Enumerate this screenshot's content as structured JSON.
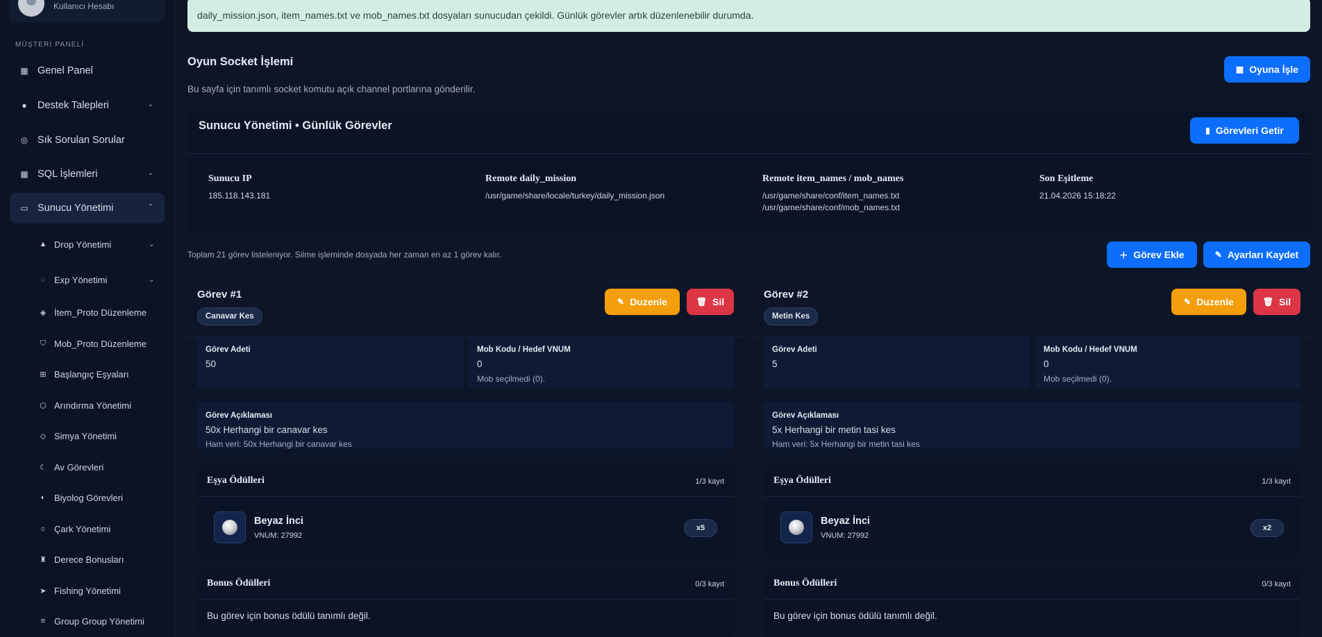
{
  "sidebar": {
    "user_subtitle": "Kullanıcı Hesabı",
    "section_label": "MÜŞTERİ PANELİ",
    "items": [
      {
        "label": "Genel Panel"
      },
      {
        "label": "Destek Talepleri"
      },
      {
        "label": "Sık Sorulan Sorular"
      },
      {
        "label": "SQL İşlemleri"
      },
      {
        "label": "Sunucu Yönetimi"
      }
    ],
    "sub_items": [
      {
        "label": "Drop Yönetimi"
      },
      {
        "label": "Exp Yönetimi"
      },
      {
        "label": "İtem_Proto Düzenleme"
      },
      {
        "label": "Mob_Proto Düzenleme"
      },
      {
        "label": "Başlangıç Eşyaları"
      },
      {
        "label": "Arındırma Yönetimi"
      },
      {
        "label": "Simya Yönetimi"
      },
      {
        "label": "Av Görevleri"
      },
      {
        "label": "Biyolog Görevleri"
      },
      {
        "label": "Çark Yönetimi"
      },
      {
        "label": "Derece Bonusları"
      },
      {
        "label": "Fishing Yönetimi"
      },
      {
        "label": "Group Group Yönetimi"
      }
    ]
  },
  "alert": {
    "text": "daily_mission.json, item_names.txt ve mob_names.txt dosyaları sunucudan çekildi. Günlük görevler artık düzenlenebilir durumda."
  },
  "header": {
    "title": "Oyun Socket İşlemi",
    "description": "Bu sayfa için tanımlı socket komutu açık channel portlarına gönderilir.",
    "apply_button": "Oyuna İşle"
  },
  "panel": {
    "title": "Sunucu Yönetimi • Günlük Görevler",
    "fetch_button": "Görevleri Getir",
    "info": [
      {
        "label": "Sunucu IP",
        "values": [
          "185.118.143.181"
        ]
      },
      {
        "label": "Remote daily_mission",
        "values": [
          "/usr/game/share/locale/turkey/daily_mission.json"
        ]
      },
      {
        "label": "Remote item_names / mob_names",
        "values": [
          "/usr/game/share/conf/item_names.txt",
          "/usr/game/share/conf/mob_names.txt"
        ]
      },
      {
        "label": "Son Eşitleme",
        "values": [
          "21.04.2026 15:18:22"
        ]
      }
    ]
  },
  "list": {
    "total_text": "Toplam 21 görev listeleniyor. Silme işleminde dosyada her zaman en az 1 görev kalır.",
    "add_button": "Görev Ekle",
    "save_button": "Ayarları Kaydet"
  },
  "cards": [
    {
      "title": "Görev #1",
      "tag": "Canavar Kes",
      "edit_button": "Duzenle",
      "delete_button": "Sil",
      "count_label": "Görev Adeti",
      "count_value": "50",
      "mob_label": "Mob Kodu / Hedef VNUM",
      "mob_value": "0",
      "mob_hint": "Mob seçilmedi (0).",
      "desc_label": "Görev Açıklaması",
      "desc_value": "50x Herhangi bir canavar kes",
      "desc_raw": "Ham veri: 50x Herhangi bir canavar kes",
      "items_title": "Eşya Ödülleri",
      "items_count": "1/3 kayıt",
      "reward_name": "Beyaz İnci",
      "reward_vnum": "VNUM: 27992",
      "reward_qty": "x5",
      "bonus_title": "Bonus Ödülleri",
      "bonus_count": "0/3 kayıt",
      "bonus_empty": "Bu görev için bonus ödülü tanımlı değil."
    },
    {
      "title": "Görev #2",
      "tag": "Metin Kes",
      "edit_button": "Duzenle",
      "delete_button": "Sil",
      "count_label": "Görev Adeti",
      "count_value": "5",
      "mob_label": "Mob Kodu / Hedef VNUM",
      "mob_value": "0",
      "mob_hint": "Mob seçilmedi (0).",
      "desc_label": "Görev Açıklaması",
      "desc_value": "5x Herhangi bir metin tasi kes",
      "desc_raw": "Ham veri: 5x Herhangi bir metin tasi kes",
      "items_title": "Eşya Ödülleri",
      "items_count": "1/3 kayıt",
      "reward_name": "Beyaz İnci",
      "reward_vnum": "VNUM: 27992",
      "reward_qty": "x2",
      "bonus_title": "Bonus Ödülleri",
      "bonus_count": "0/3 kayıt",
      "bonus_empty": "Bu görev için bonus ödülü tanımlı değil."
    }
  ],
  "colors": {
    "primary": "#0d6efd",
    "warning": "#f59e0b",
    "danger": "#dc3545",
    "alert_bg": "#d4ede3"
  }
}
